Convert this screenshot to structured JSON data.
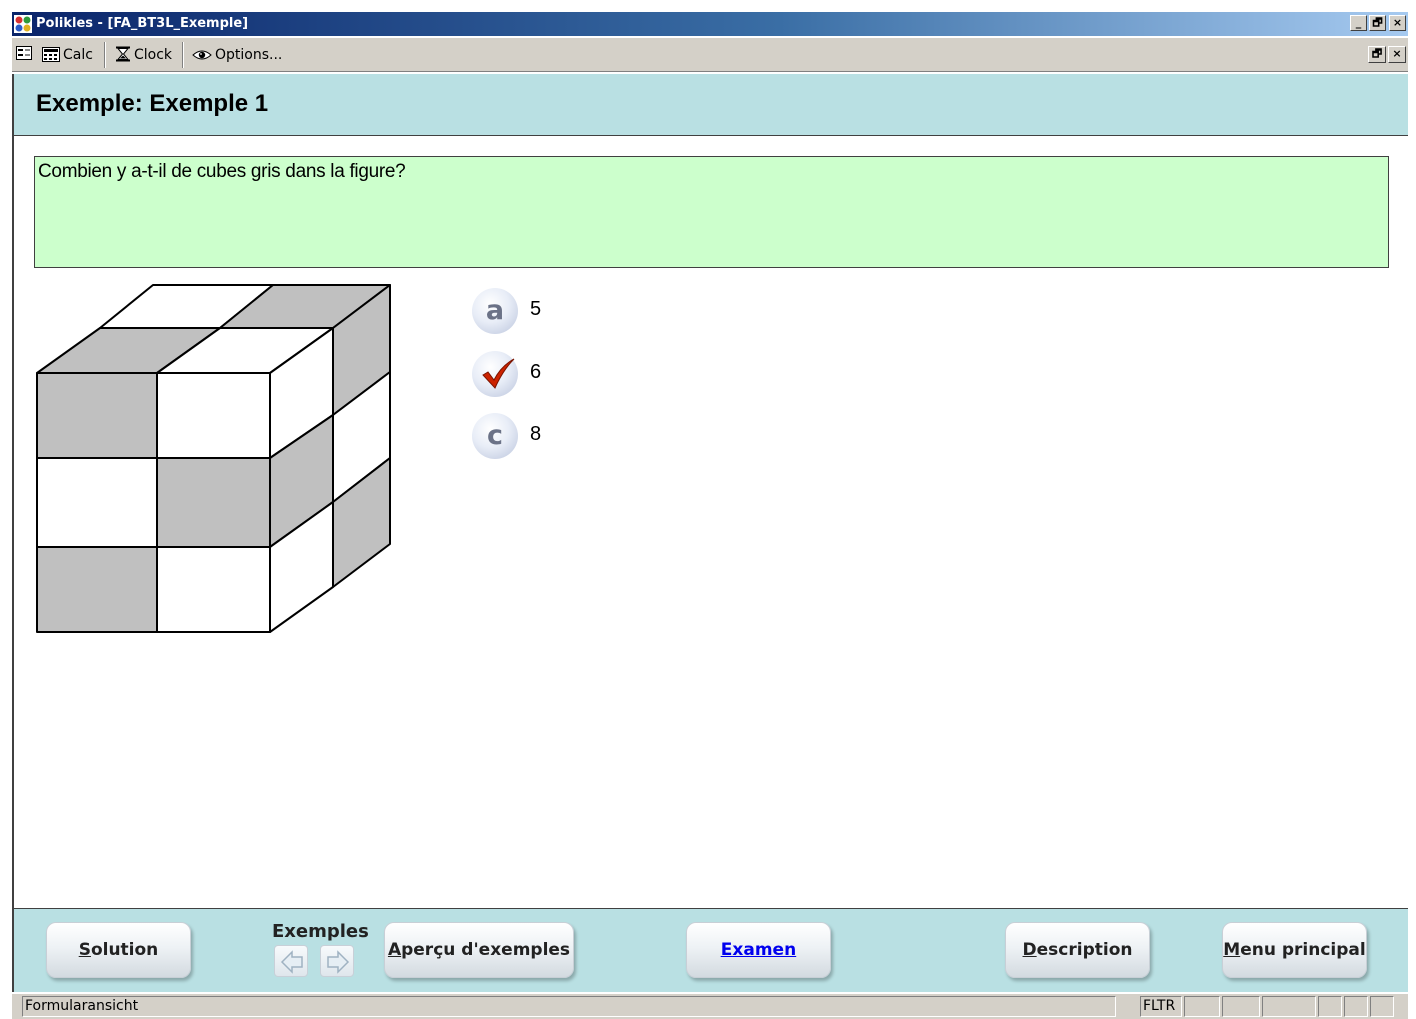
{
  "window": {
    "title": "Polikles - [FA_BT3L_Exemple]",
    "minimize_glyph": "_",
    "restore_glyph": "🗗",
    "close_glyph": "×"
  },
  "toolbar": {
    "calc_label": "Calc",
    "clock_label": "Clock",
    "options_label": "Options...",
    "icons": [
      "form-icon",
      "calculator-icon",
      "hourglass-icon",
      "eye-icon"
    ]
  },
  "page": {
    "title": "Exemple: Exemple 1"
  },
  "question": {
    "text": "Combien y a-t-il de cubes gris dans la figure?"
  },
  "answers": [
    {
      "glyph": "a",
      "value": "5",
      "selected": false
    },
    {
      "glyph": "✓",
      "value": "6",
      "selected": true
    },
    {
      "glyph": "c",
      "value": "8",
      "selected": false
    }
  ],
  "footer": {
    "solution_label": "Solution",
    "exemples_label": "Exemples",
    "apercu_label": "Aperçu d'exemples",
    "examen_label": "Examen",
    "description_label": "Description",
    "menu_label": "Menu principal"
  },
  "statusbar": {
    "left_text": "Formularansicht",
    "mode_text": "FLTR"
  },
  "colors": {
    "header_band": "#b9e0e3",
    "question_bg": "#ccffcc",
    "cube_grey": "#c0c0c0",
    "check_red": "#cc2200",
    "link_blue": "#0000ee"
  }
}
